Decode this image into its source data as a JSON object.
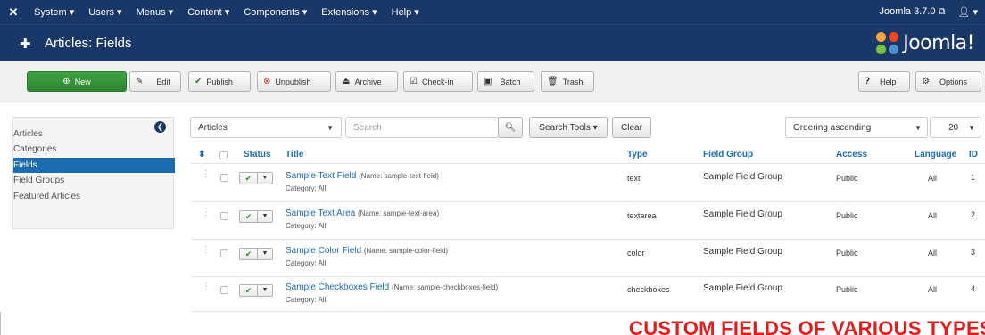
{
  "navbar": {
    "logo_icon": "joomla-icon",
    "menu": [
      "System ▾",
      "Users ▾",
      "Menus ▾",
      "Content ▾",
      "Components ▾",
      "Extensions ▾",
      "Help ▾"
    ],
    "version": "Joomla 3.7.0 ⧉",
    "user_icon": "user-icon"
  },
  "header": {
    "icon": "puzzle-icon",
    "title": "Articles: Fields",
    "brand": "Joomla!"
  },
  "toolbar": {
    "new": "New",
    "edit": "Edit",
    "publish": "Publish",
    "unpublish": "Unpublish",
    "archive": "Archive",
    "checkin": "Check-in",
    "batch": "Batch",
    "trash": "Trash",
    "help": "Help",
    "options": "Options"
  },
  "sidebar": {
    "items": [
      "Articles",
      "Categories",
      "Fields",
      "Field Groups",
      "Featured Articles"
    ],
    "active": "Fields"
  },
  "filters": {
    "context": "Articles",
    "search_placeholder": "Search",
    "search_tools": "Search Tools ▾",
    "clear": "Clear",
    "ordering": "Ordering ascending",
    "limit": "20"
  },
  "table": {
    "headers": {
      "sort": "⬍",
      "status": "Status",
      "title": "Title",
      "type": "Type",
      "group": "Field Group",
      "access": "Access",
      "language": "Language",
      "id": "ID"
    },
    "rows": [
      {
        "title": "Sample Text Field",
        "name": "(Name: sample-text-field)",
        "category": "Category: All",
        "type": "text",
        "group": "Sample Field Group",
        "access": "Public",
        "language": "All",
        "id": "1"
      },
      {
        "title": "Sample Text Area",
        "name": "(Name: sample-text-area)",
        "category": "Category: All",
        "type": "textarea",
        "group": "Sample Field Group",
        "access": "Public",
        "language": "All",
        "id": "2"
      },
      {
        "title": "Sample Color Field",
        "name": "(Name: sample-color-field)",
        "category": "Category: All",
        "type": "color",
        "group": "Sample Field Group",
        "access": "Public",
        "language": "All",
        "id": "3"
      },
      {
        "title": "Sample Checkboxes Field",
        "name": "(Name: sample-checkboxes-field)",
        "category": "Category: All",
        "type": "checkboxes",
        "group": "Sample Field Group",
        "access": "Public",
        "language": "All",
        "id": "4"
      }
    ]
  },
  "banner": "CUSTOM FIELDS OF VARIOUS TYPES",
  "colors": {
    "nav_bg": "#1a3867",
    "accent_blue": "#1d6cb0",
    "new_green": "#3fa142",
    "banner_red": "#e21b1b"
  }
}
